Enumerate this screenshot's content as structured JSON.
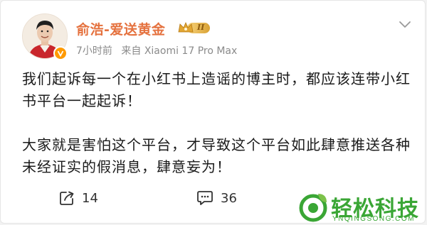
{
  "post": {
    "author": "俞浩-爱送黄金",
    "member_level": "II",
    "time": "7小时前",
    "source": "来自 Xiaomi 17 Pro Max",
    "paragraphs": [
      "我们起诉每一个在小红书上造谣的博主时，都应该连带小红书平台一起起诉！",
      "大家就是害怕这个平台，才导致这个平台如此肆意推送各种未经证实的假消息，肆意妄为！"
    ],
    "actions": {
      "repost_count": "14",
      "comment_count": "36"
    }
  },
  "icons": {
    "more": "chevron-down-icon",
    "repost": "share-icon",
    "comment": "comment-icon"
  },
  "watermark": {
    "title": "轻松科技",
    "subtitle": "YNQINGSONG.COM"
  },
  "colors": {
    "author": "#e5723f",
    "meta": "#8a8a8a",
    "watermark": "#3aa635",
    "badge": "#ff9a00"
  }
}
